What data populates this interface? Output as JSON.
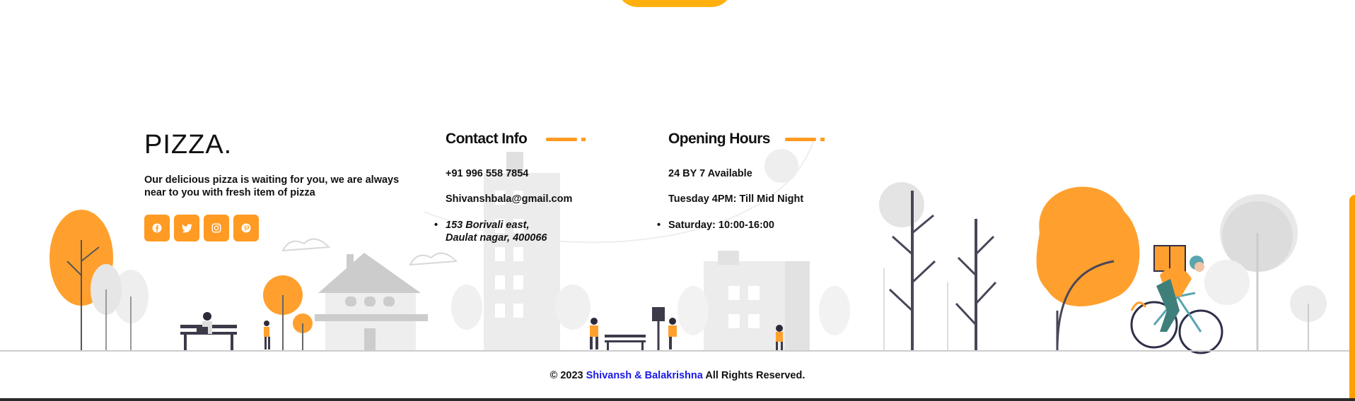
{
  "brand": {
    "name": "PIZZA.",
    "tagline": "Our delicious pizza is waiting for you, we are always near to you with fresh item of pizza"
  },
  "socials": [
    {
      "icon": "facebook-icon"
    },
    {
      "icon": "twitter-icon"
    },
    {
      "icon": "instagram-icon"
    },
    {
      "icon": "pinterest-icon"
    }
  ],
  "contact": {
    "title": "Contact Info",
    "phone": "+91 996 558 7854",
    "email": "Shivanshbala@gmail.com",
    "address_line1": "153 Borivali east,",
    "address_line2": "Daulat nagar, 400066"
  },
  "hours": {
    "title": "Opening Hours",
    "line1": "24 BY 7 Available",
    "line2": "Tuesday 4PM: Till Mid Night",
    "line3": "Saturday: 10:00-16:00"
  },
  "footer": {
    "prefix": "© 2023",
    "authors": "Shivansh & Balakrishna",
    "suffix": "All Rights Reserved."
  },
  "colors": {
    "accent": "#ff9a22",
    "top_pill": "#ffb00f",
    "link": "#1a1ae6",
    "illustration_gray": "#e0e0e0"
  }
}
